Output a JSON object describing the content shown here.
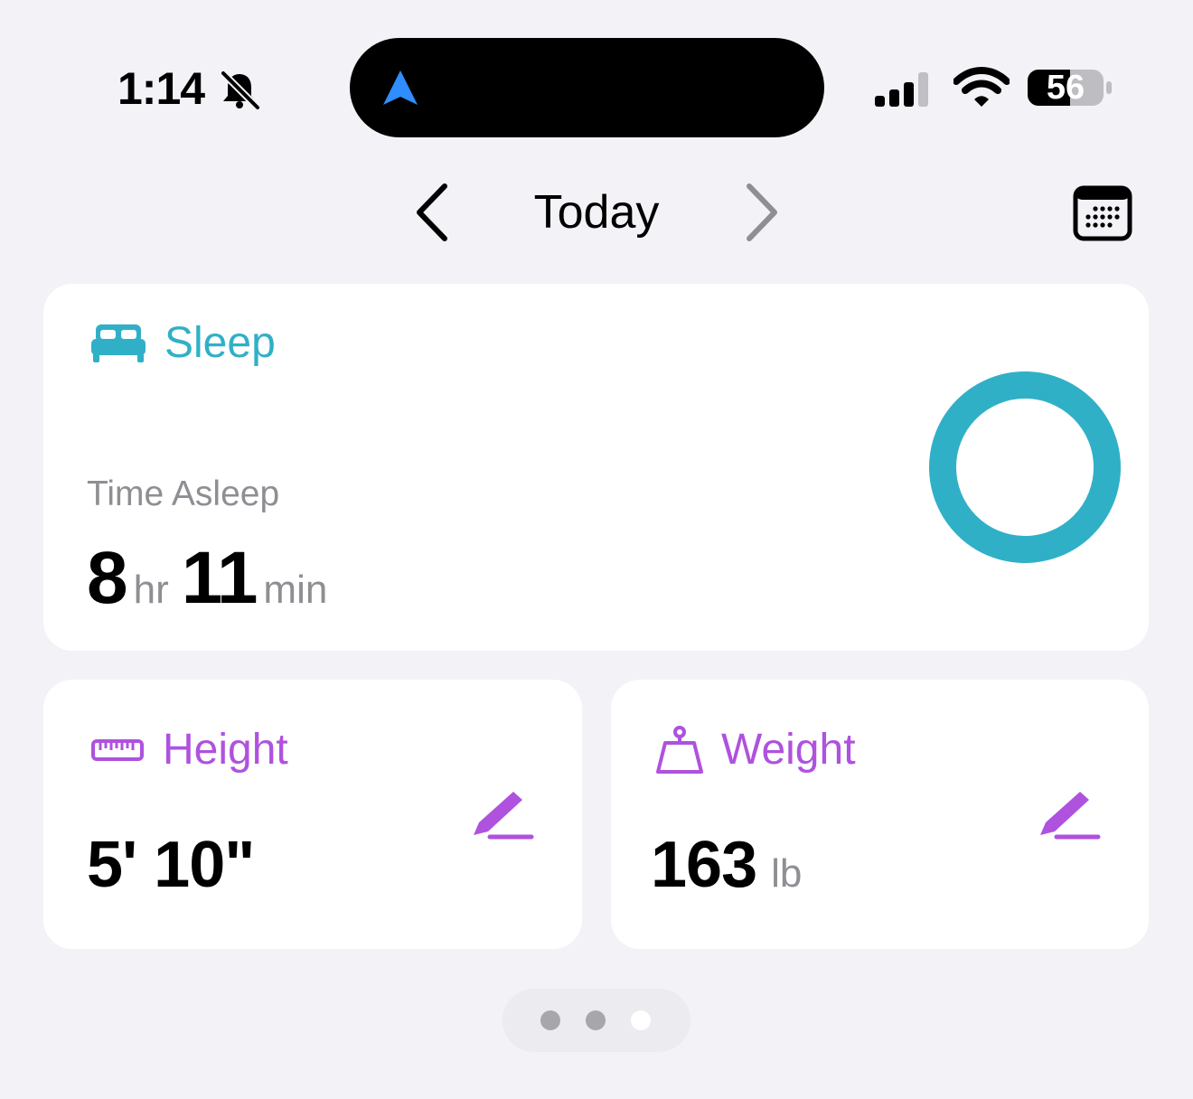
{
  "status_bar": {
    "time": "1:14",
    "battery_level": "56",
    "icons": [
      "bell-slash-icon",
      "navigation-arrow-icon",
      "cellular-signal-icon",
      "wifi-icon",
      "battery-icon"
    ]
  },
  "date_nav": {
    "title": "Today",
    "icons": [
      "chevron-left-icon",
      "chevron-right-icon",
      "calendar-icon"
    ]
  },
  "sleep": {
    "title": "Sleep",
    "label": "Time Asleep",
    "hours": "8",
    "hours_unit": "hr",
    "minutes": "11",
    "minutes_unit": "min",
    "icon": "bed-icon",
    "color": "#30b0c7"
  },
  "height": {
    "title": "Height",
    "value": "5' 10\"",
    "icon": "ruler-icon",
    "color": "#af52de"
  },
  "weight": {
    "title": "Weight",
    "value": "163",
    "unit": "lb",
    "icon": "scale-weight-icon",
    "color": "#af52de"
  },
  "pager": {
    "pages": 3,
    "active_page": 3
  }
}
